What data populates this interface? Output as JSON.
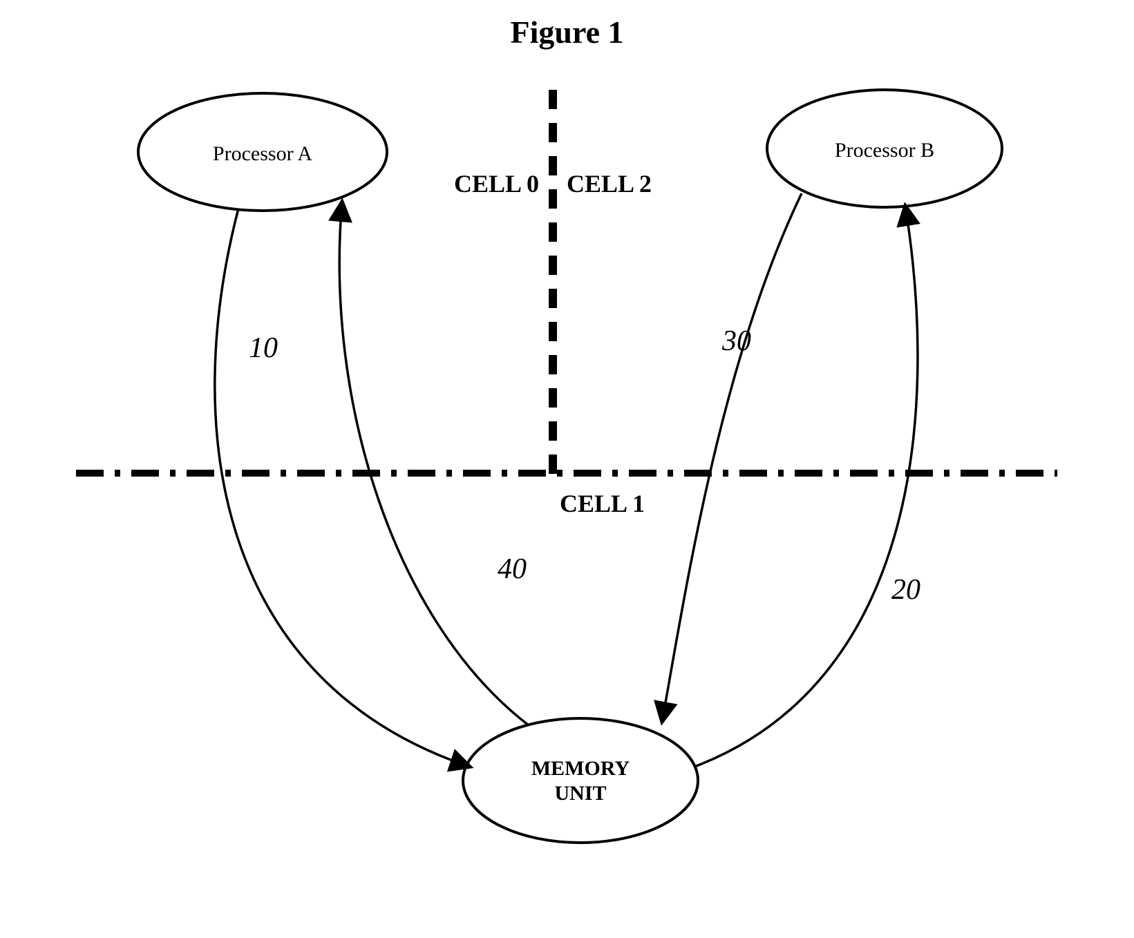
{
  "title": "Figure 1",
  "nodes": {
    "procA": "Processor A",
    "procB": "Processor B",
    "mem_line1": "MEMORY",
    "mem_line2": "UNIT"
  },
  "cells": {
    "cell0": "CELL 0",
    "cell1": "CELL 1",
    "cell2": "CELL 2"
  },
  "edge_labels": {
    "e10": "10",
    "e20": "20",
    "e30": "30",
    "e40": "40"
  }
}
